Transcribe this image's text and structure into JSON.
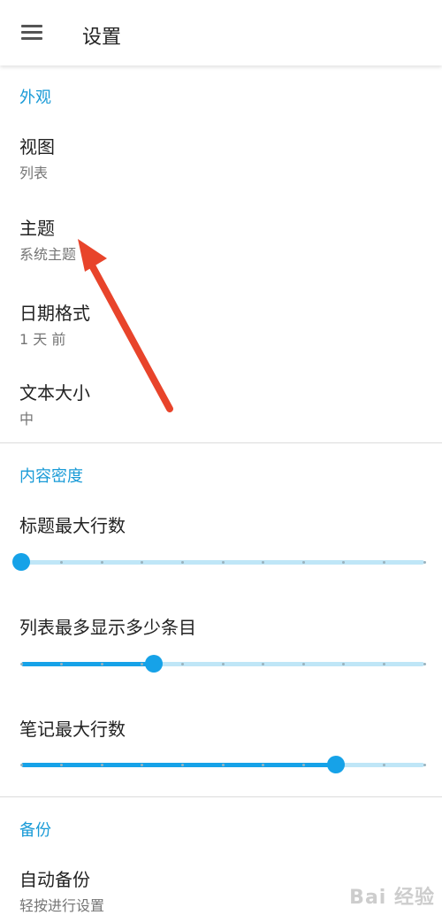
{
  "toolbar": {
    "title": "设置",
    "menu_icon": "menu-icon"
  },
  "appearance": {
    "header": "外观",
    "items": [
      {
        "title": "视图",
        "summary": "列表"
      },
      {
        "title": "主题",
        "summary": "系统主题"
      },
      {
        "title": "日期格式",
        "summary": "1 天 前"
      },
      {
        "title": "文本大小",
        "summary": "中"
      }
    ]
  },
  "density": {
    "header": "内容密度",
    "sliders": [
      {
        "title": "标题最大行数",
        "value": 0.0
      },
      {
        "title": "列表最多显示多少条目",
        "value": 0.33
      },
      {
        "title": "笔记最大行数",
        "value": 0.78
      }
    ],
    "ticks": 10
  },
  "backup": {
    "header": "备份",
    "items": [
      {
        "title": "自动备份",
        "summary": "轻按进行设置"
      }
    ]
  },
  "watermark": "Bai 经验",
  "colors": {
    "accent": "#1a9bd7",
    "slider": "#16a2e8",
    "arrow": "#e8442b"
  }
}
